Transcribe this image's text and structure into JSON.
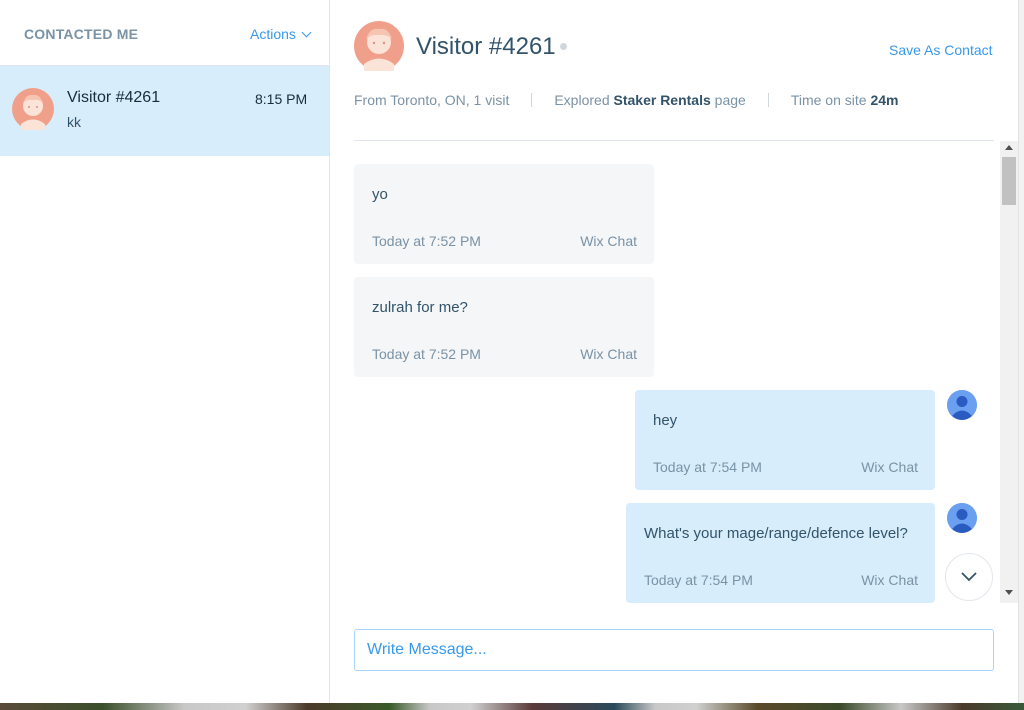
{
  "sidebar": {
    "title": "CONTACTED ME",
    "actions_label": "Actions",
    "conversations": [
      {
        "name": "Visitor #4261",
        "time": "8:15 PM",
        "preview": "kk"
      }
    ]
  },
  "header": {
    "visitor_name": "Visitor #4261",
    "save_contact_label": "Save As Contact",
    "location": "From Toronto, ON, 1 visit",
    "explored_prefix": "Explored",
    "explored_page": "Staker Rentals",
    "explored_suffix": "page",
    "time_prefix": "Time on site",
    "time_value": "24m"
  },
  "messages": [
    {
      "direction": "in",
      "text": "yo",
      "timestamp": "Today at 7:52 PM",
      "source": "Wix Chat"
    },
    {
      "direction": "in",
      "text": "zulrah for me?",
      "timestamp": "Today at 7:52 PM",
      "source": "Wix Chat"
    },
    {
      "direction": "out",
      "text": "hey",
      "timestamp": "Today at 7:54 PM",
      "source": "Wix Chat"
    },
    {
      "direction": "out",
      "text": "What's your mage/range/defence level?",
      "timestamp": "Today at 7:54 PM",
      "source": "Wix Chat"
    }
  ],
  "composer": {
    "placeholder": "Write Message..."
  },
  "colors": {
    "accent": "#3899ec",
    "selected_row": "#d7edfb",
    "incoming_bubble": "#f4f6f8",
    "outgoing_bubble": "#d7edfb",
    "visitor_avatar": "#f0a08a",
    "agent_avatar": "#6b9ff0"
  },
  "icons": {
    "visitor_avatar": "visitor-avatar-icon",
    "agent_avatar": "agent-avatar-icon",
    "scroll_down": "chevron-down-icon",
    "actions_dropdown": "chevron-down-icon",
    "status": "status-dot-icon"
  }
}
